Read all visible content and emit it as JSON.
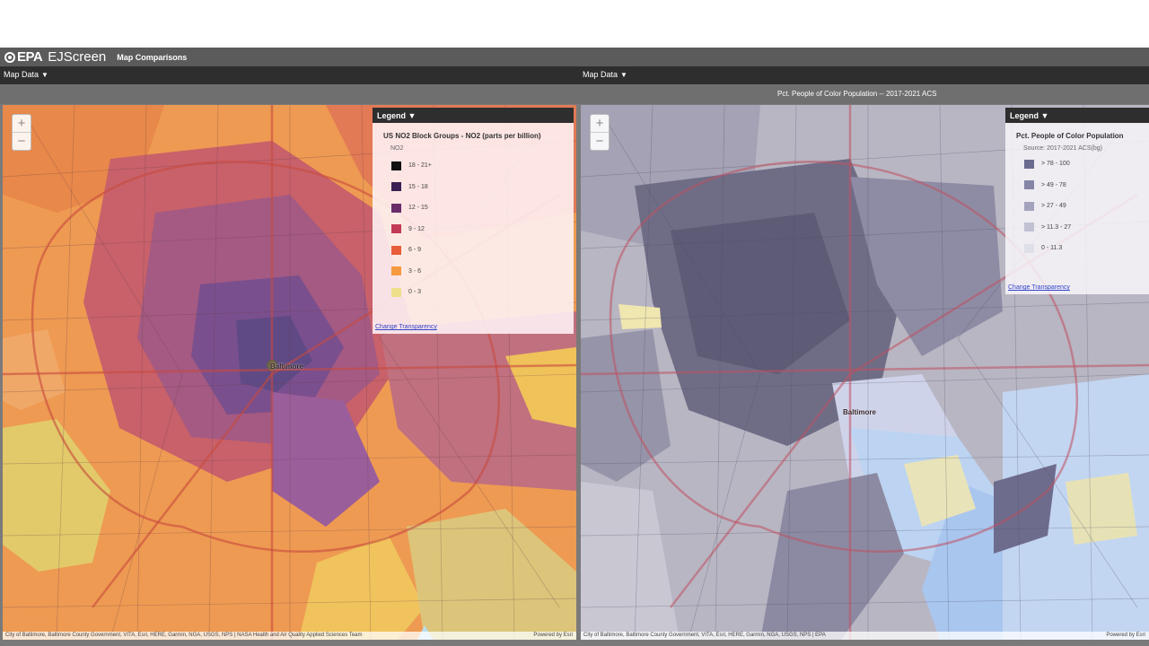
{
  "header": {
    "brand": "EPA",
    "app_name": "EJScreen",
    "subtitle": "Map Comparisons"
  },
  "menubar": {
    "left_menu": "Map Data",
    "right_menu": "Map Data",
    "caret": "▼"
  },
  "right_map_title": "Pct. People of Color Population -- 2017-2021 ACS",
  "left_map": {
    "zoom_in": "+",
    "zoom_out": "−",
    "place_label": "Baltimore",
    "legend": {
      "header": "Legend ▼",
      "title": "US NO2 Block Groups - NO2 (parts per billion)",
      "subtitle": "NO2",
      "items": [
        {
          "label": "18 - 21+",
          "color": "#111111"
        },
        {
          "label": "15 - 18",
          "color": "#3a1f55"
        },
        {
          "label": "12 - 15",
          "color": "#6a2b6b"
        },
        {
          "label": "9 - 12",
          "color": "#c23a55"
        },
        {
          "label": "6 - 9",
          "color": "#e85d3a"
        },
        {
          "label": "3 - 6",
          "color": "#f59a40"
        },
        {
          "label": "0 - 3",
          "color": "#eee08a"
        }
      ],
      "link": "Change Transparency"
    },
    "attribution": "City of Baltimore, Baltimore County Government, VITA, Esri, HERE, Garmin, NGA, USGS, NPS | NASA Health and Air Quality Applied Sciences Team",
    "powered": "Powered by Esri"
  },
  "right_map": {
    "zoom_in": "+",
    "zoom_out": "−",
    "place_label": "Baltimore",
    "legend": {
      "header": "Legend ▼",
      "title": "Pct. People of Color Population",
      "subtitle": "Source: 2017-2021 ACS(bg)",
      "items": [
        {
          "label": "> 78 - 100",
          "color": "#6b6b8f"
        },
        {
          "label": "> 49 - 78",
          "color": "#8585a6"
        },
        {
          "label": "> 27 - 49",
          "color": "#a3a3bd"
        },
        {
          "label": "> 11.3 - 27",
          "color": "#c1c1d3"
        },
        {
          "label": "0 - 11.3",
          "color": "#dfdfea"
        }
      ],
      "link": "Change Transparency"
    },
    "attribution": "City of Baltimore, Baltimore County Government, VITA, Esri, HERE, Garmin, NGA, USGS, NPS | EPA",
    "powered": "Powered by Esri"
  }
}
